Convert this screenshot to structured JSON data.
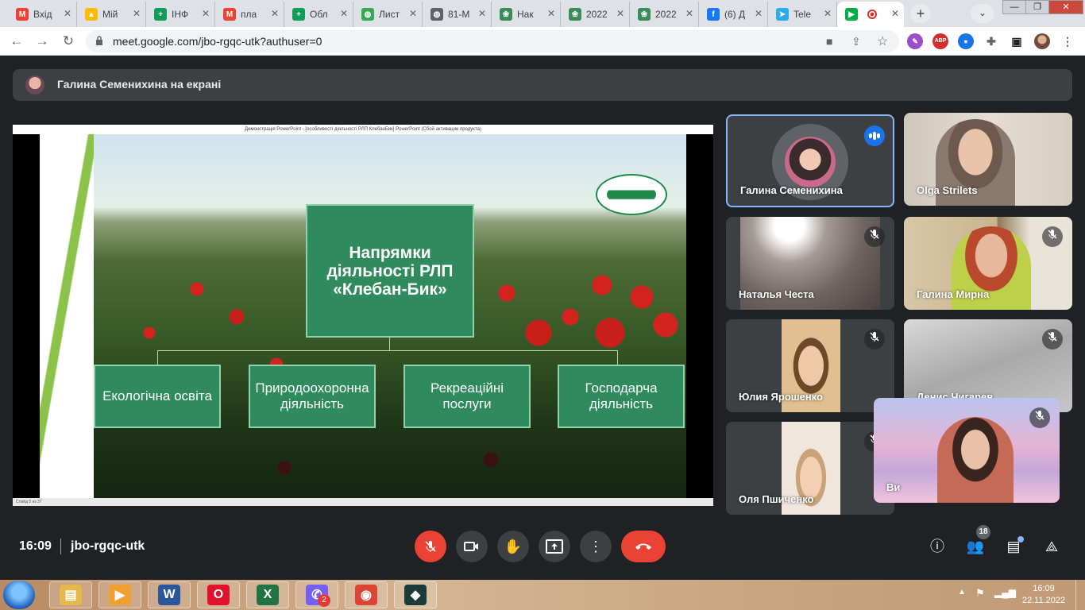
{
  "browser": {
    "tabs": [
      {
        "label": "Вхід",
        "color": "#ea4335",
        "glyph": "M"
      },
      {
        "label": "Мій",
        "color": "#fbbc04",
        "glyph": "▲"
      },
      {
        "label": "ІНФ",
        "color": "#0f9d58",
        "glyph": "+"
      },
      {
        "label": "пла",
        "color": "#ea4335",
        "glyph": "M"
      },
      {
        "label": "Обл",
        "color": "#0f9d58",
        "glyph": "+"
      },
      {
        "label": "Лист",
        "color": "#34a853",
        "glyph": "◍"
      },
      {
        "label": "81-М",
        "color": "#5f6368",
        "glyph": "◍"
      },
      {
        "label": "Нак",
        "color": "#3c8c5a",
        "glyph": "❀"
      },
      {
        "label": "2022",
        "color": "#3c8c5a",
        "glyph": "❀"
      },
      {
        "label": "2022",
        "color": "#3c8c5a",
        "glyph": "❀"
      },
      {
        "label": "(6) Д",
        "color": "#1877f2",
        "glyph": "f"
      },
      {
        "label": "Tele",
        "color": "#2aabee",
        "glyph": "➤"
      }
    ],
    "active_tab": {
      "close": "✕"
    },
    "new_tab": "+",
    "tab_search": "⌄",
    "window": {
      "minimize": "—",
      "restore": "❐",
      "close": "✕"
    },
    "url": "meet.google.com/jbo-rgqc-utk?authuser=0",
    "extensions": {
      "abp": "ABP"
    }
  },
  "meet": {
    "presenting_text": "Галина Семенихина на екрані",
    "slide": {
      "ppt_title": "Демонстрація PowerPoint - [особливості діяльності РЛП КлебанБик]    PowerPoint (Сбой активации продукта)",
      "status": "Слайд 5 из 37",
      "main_title": "Напрямки діяльності РЛП «Клебан-Бик»",
      "boxes": [
        "Екологічна освіта",
        "Природоохоронна діяльність",
        "Рекреаційні послуги",
        "Господарча діяльність"
      ]
    },
    "participants": [
      {
        "name": "Галина Семенихина"
      },
      {
        "name": "Olga Strilets"
      },
      {
        "name": "Наталья Честа"
      },
      {
        "name": "Галина Мирна"
      },
      {
        "name": "Юлия Ярошенко"
      },
      {
        "name": "Денис Чигарев"
      },
      {
        "name": "Оля Пшиченко"
      }
    ],
    "self_label": "Ви",
    "clock": "16:09",
    "meeting_code": "jbo-rgqc-utk",
    "people_count": "18"
  },
  "taskbar": {
    "apps": [
      {
        "name": "explorer",
        "color": "#e6b84a",
        "glyph": "▤"
      },
      {
        "name": "media",
        "color": "#f0a030",
        "glyph": "▶"
      },
      {
        "name": "word",
        "color": "#2b579a",
        "glyph": "W"
      },
      {
        "name": "opera",
        "color": "#e3122c",
        "glyph": "O"
      },
      {
        "name": "excel",
        "color": "#217346",
        "glyph": "X"
      },
      {
        "name": "viber",
        "color": "#7360f2",
        "glyph": "✆"
      },
      {
        "name": "chrome",
        "color": "#db4437",
        "glyph": "◉"
      },
      {
        "name": "filmora",
        "color": "#1b3a3a",
        "glyph": "◆"
      }
    ],
    "viber_badge": "2",
    "time": "16:09",
    "date": "22.11.2022"
  }
}
